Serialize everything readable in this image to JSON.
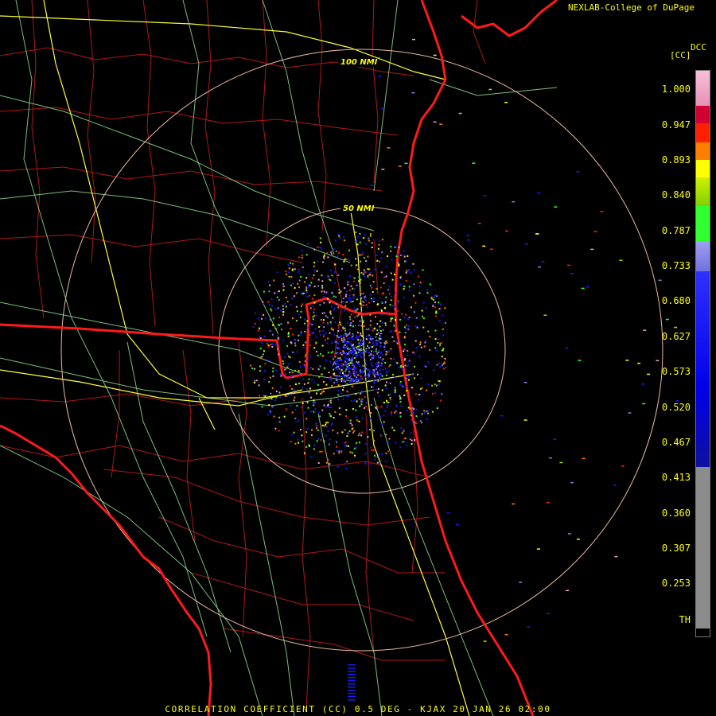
{
  "credit": "NEXLAB-College of DuPage",
  "legend": {
    "product": "DCC",
    "units": "[CC]",
    "ticks": [
      "1.000",
      "0.947",
      "0.893",
      "0.840",
      "0.787",
      "0.733",
      "0.680",
      "0.627",
      "0.573",
      "0.520",
      "0.467",
      "0.413",
      "0.360",
      "0.307",
      "0.253",
      "TH"
    ],
    "colors": {
      "pink": "#f2a0c8",
      "crimson": "#d00030",
      "red": "#ff2000",
      "orange": "#ff8000",
      "yellow": "#ffff00",
      "yellowgreen": "#a0e000",
      "green": "#30ff30",
      "lavender": "#8080e0",
      "blue": "#1818ff",
      "gray": "#8c8c8c"
    }
  },
  "range_rings": [
    {
      "label": "100 NMI"
    },
    {
      "label": "50 NMI"
    }
  ],
  "footer": "CORRELATION COEFFICIENT (CC) 0.5 DEG - KJAX 20 JAN 26 02:00"
}
